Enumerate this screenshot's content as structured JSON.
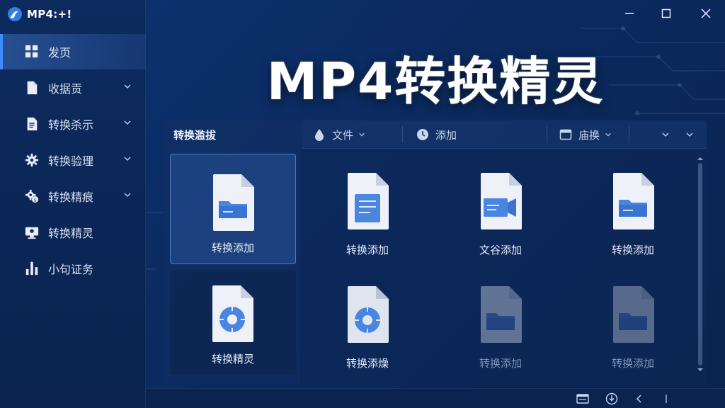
{
  "app": {
    "title": "MP4:+!",
    "hero_title": "MP4转换精灵"
  },
  "sidebar": {
    "items": [
      {
        "label": "发页",
        "icon": "grid-icon",
        "active": true,
        "has_chevron": false
      },
      {
        "label": "收据贡",
        "icon": "document-icon",
        "active": false,
        "has_chevron": true
      },
      {
        "label": "转换杀示",
        "icon": "list-document-icon",
        "active": false,
        "has_chevron": true
      },
      {
        "label": "转换验理",
        "icon": "gear-icon",
        "active": false,
        "has_chevron": true
      },
      {
        "label": "转换精痕",
        "icon": "gear-badge-icon",
        "active": false,
        "has_chevron": true
      },
      {
        "label": "转换精灵",
        "icon": "monitor-icon",
        "active": false,
        "has_chevron": false
      },
      {
        "label": "小句证务",
        "icon": "bar-chart-icon",
        "active": false,
        "has_chevron": false
      }
    ]
  },
  "left_panel": {
    "title": "转换滥拔",
    "cards": [
      {
        "label": "转换添加",
        "icon": "folder-file-icon",
        "selected": true
      },
      {
        "label": "转换精灵",
        "icon": "disc-file-icon",
        "selected": false
      }
    ]
  },
  "toolbar": {
    "file_label": "文件",
    "add_label": "添加",
    "switch_label": "庙换"
  },
  "grid": {
    "items": [
      {
        "label": "转换添加",
        "icon": "text-file-icon",
        "dim": false
      },
      {
        "label": "文谷添加",
        "icon": "video-file-icon",
        "dim": false
      },
      {
        "label": "转换添加",
        "icon": "folder-file-icon",
        "dim": false
      },
      {
        "label": "转换添燥",
        "icon": "disc-file-icon",
        "dim": false
      },
      {
        "label": "转换添加",
        "icon": "folder-file-icon",
        "dim": true
      },
      {
        "label": "转换添加",
        "icon": "folder-file-icon",
        "dim": true
      }
    ]
  },
  "colors": {
    "accent": "#3d8bff",
    "background": "#0c2a5c",
    "icon_blue": "#4a86e0"
  }
}
